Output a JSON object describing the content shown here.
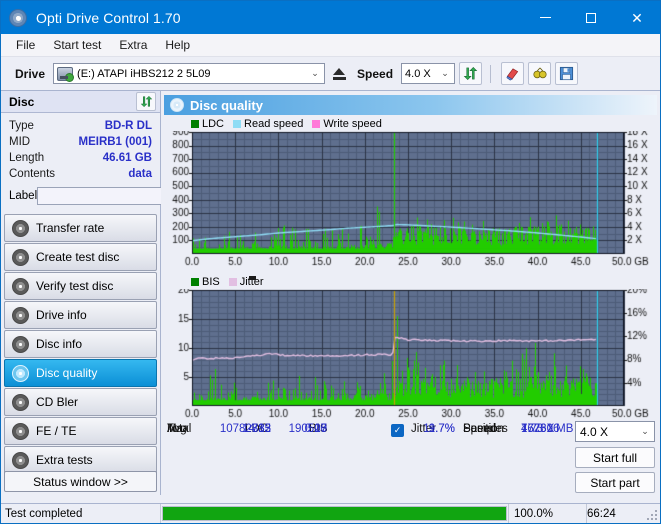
{
  "window": {
    "title": "Opti Drive Control 1.70",
    "app_icon": "disc-icon",
    "minimize": "–",
    "maximize": "□",
    "close": "✕"
  },
  "menu": {
    "items": [
      "File",
      "Start test",
      "Extra",
      "Help"
    ]
  },
  "toolbar": {
    "drive_label": "Drive",
    "drive_value": "(E:)  ATAPI iHBS212  2 5L09",
    "drive_icon": "drive-icon",
    "eject_icon": "eject-icon",
    "speed_label": "Speed",
    "speed_value": "4.0 X",
    "refresh_icon": "refresh-icon",
    "eraser_icon": "eraser-icon",
    "glasses_icon": "glasses-icon",
    "save_icon": "save-icon",
    "chevron": "⌄"
  },
  "disc_panel": {
    "header": "Disc",
    "refresh_icon": "refresh-icon",
    "rows": [
      {
        "key": "Type",
        "value": "BD-R DL"
      },
      {
        "key": "MID",
        "value": "MEIRB1 (001)"
      },
      {
        "key": "Length",
        "value": "46.61 GB"
      },
      {
        "key": "Contents",
        "value": "data"
      }
    ],
    "label_key": "Label",
    "label_value": "",
    "label_placeholder": "",
    "disc_icon": "cd-icon"
  },
  "sidebar": {
    "items": [
      {
        "label": "Transfer rate",
        "selected": false
      },
      {
        "label": "Create test disc",
        "selected": false
      },
      {
        "label": "Verify test disc",
        "selected": false
      },
      {
        "label": "Drive info",
        "selected": false
      },
      {
        "label": "Disc info",
        "selected": false
      },
      {
        "label": "Disc quality",
        "selected": true
      },
      {
        "label": "CD Bler",
        "selected": false
      },
      {
        "label": "FE / TE",
        "selected": false
      },
      {
        "label": "Extra tests",
        "selected": false
      }
    ],
    "status_window_button": "Status window >>"
  },
  "content": {
    "header_title": "Disc quality",
    "header_icon": "disc-quality-icon"
  },
  "stats": {
    "col_headers": [
      "LDC",
      "BIS"
    ],
    "row_labels": [
      "Avg",
      "Max",
      "Total"
    ],
    "ldc": {
      "avg": "14.12",
      "max": "883",
      "total": "10782735"
    },
    "bis": {
      "avg": "0.25",
      "max": "17",
      "total": "190500"
    },
    "jitter": {
      "label": "Jitter",
      "checked": true,
      "check_glyph": "✓",
      "avg": "9.7%",
      "max": "11.7%"
    },
    "speed_label": "Speed",
    "speed_value": "1.73 X",
    "position_label": "Position",
    "position_value": "47731 MB",
    "samples_label": "Samples",
    "samples_value": "762606",
    "speed_select": "4.0 X",
    "speed_select_chevron": "⌄",
    "start_full_button": "Start full",
    "start_part_button": "Start part"
  },
  "statusbar": {
    "message": "Test completed",
    "percent_text": "100.0%",
    "percent_value": 100,
    "elapsed": "66:24"
  },
  "colors": {
    "accent": "#0078d4",
    "plot_bg": "#5f6f8e",
    "grid_major": "#2b3345",
    "grid_minor": "#4d5c78",
    "ldc_green": "#22cc00",
    "bis_green": "#22cc00",
    "read_speed": "#8fdcf5",
    "write_speed": "#ff7ad9",
    "jitter": "#e2bfe2",
    "value_blue": "#2a30c8",
    "progress_green": "#11a511"
  },
  "chart_data": [
    {
      "type": "area",
      "name": "ldc-chart",
      "title": "Disc quality",
      "legend": [
        {
          "label": "LDC",
          "color": "#008000"
        },
        {
          "label": "Read speed",
          "color": "#8fdcf5"
        },
        {
          "label": "Write speed",
          "color": "#ff7ad9"
        }
      ],
      "legend_position": "top-left",
      "grid": true,
      "xlabel": "GB",
      "xlim": [
        0,
        50
      ],
      "xticks": [
        0.0,
        5.0,
        10.0,
        15.0,
        20.0,
        25.0,
        30.0,
        35.0,
        40.0,
        45.0,
        50.0
      ],
      "xticklabels": [
        "0.0",
        "5.0",
        "10.0",
        "15.0",
        "20.0",
        "25.0",
        "30.0",
        "35.0",
        "40.0",
        "45.0",
        "50.0 GB"
      ],
      "ylabel": "LDC",
      "ylim": [
        0,
        900
      ],
      "yticks": [
        100,
        200,
        300,
        400,
        500,
        600,
        700,
        800,
        900
      ],
      "y2label": "X",
      "y2lim": [
        0,
        18
      ],
      "y2ticks": [
        2,
        4,
        6,
        8,
        10,
        12,
        14,
        16,
        18
      ],
      "y2ticklabels": [
        "2 X",
        "4 X",
        "6 X",
        "8 X",
        "10 X",
        "12 X",
        "14 X",
        "16 X",
        "18 X"
      ],
      "data_end_gb": 46.9,
      "series": [
        {
          "name": "LDC",
          "color": "#22cc00",
          "kind": "spikes",
          "baseline": 40,
          "envelope_x": [
            0,
            3,
            6,
            10,
            14,
            18,
            21,
            23,
            23.5,
            25,
            28,
            32,
            36,
            40,
            44,
            46.9
          ],
          "envelope_y": [
            120,
            180,
            150,
            260,
            200,
            190,
            230,
            880,
            340,
            330,
            300,
            260,
            250,
            290,
            280,
            250
          ],
          "mean_x": [
            0,
            5,
            10,
            15,
            20,
            23,
            23.5,
            28,
            34,
            40,
            46.9
          ],
          "mean_y": [
            30,
            35,
            45,
            40,
            50,
            60,
            150,
            140,
            130,
            150,
            140
          ]
        },
        {
          "name": "Read speed",
          "color": "#8fdcf5",
          "kind": "line",
          "axis": "y2",
          "x": [
            0,
            2,
            5,
            8,
            10,
            13,
            16,
            18,
            20,
            22,
            23.3,
            23.6,
            25,
            28,
            31,
            34,
            37,
            40,
            43,
            45,
            46.9
          ],
          "y": [
            1.95,
            2.25,
            2.55,
            2.85,
            3.1,
            3.35,
            3.6,
            3.8,
            3.95,
            4.1,
            4.2,
            4.35,
            4.3,
            4.1,
            3.9,
            3.65,
            3.4,
            3.1,
            2.75,
            2.5,
            2.25
          ]
        },
        {
          "name": "Write speed",
          "color": "#ff7ad9",
          "kind": "line",
          "x": [],
          "y": []
        }
      ],
      "markers": [
        {
          "x": 23.4,
          "color": "#22cc00",
          "label": "layer-break-marker"
        },
        {
          "x": 46.9,
          "color": "#2fd0ef",
          "label": "end-of-data-marker"
        }
      ]
    },
    {
      "type": "area",
      "name": "bis-jitter-chart",
      "legend": [
        {
          "label": "BIS",
          "color": "#008000"
        },
        {
          "label": "Jitter",
          "color": "#e2bfe2"
        }
      ],
      "legend_position": "top-left",
      "grid": true,
      "xlabel": "GB",
      "xlim": [
        0,
        50
      ],
      "xticks": [
        0.0,
        5.0,
        10.0,
        15.0,
        20.0,
        25.0,
        30.0,
        35.0,
        40.0,
        45.0,
        50.0
      ],
      "xticklabels": [
        "0.0",
        "5.0",
        "10.0",
        "15.0",
        "20.0",
        "25.0",
        "30.0",
        "35.0",
        "40.0",
        "45.0",
        "50.0 GB"
      ],
      "ylabel": "BIS",
      "ylim": [
        0,
        20
      ],
      "yticks": [
        5,
        10,
        15,
        20
      ],
      "y2label": "%",
      "y2lim": [
        0,
        20
      ],
      "y2ticks": [
        4,
        8,
        12,
        16,
        20
      ],
      "y2ticklabels": [
        "4%",
        "8%",
        "12%",
        "16%",
        "20%"
      ],
      "data_end_gb": 46.9,
      "series": [
        {
          "name": "BIS",
          "color": "#22cc00",
          "kind": "spikes",
          "baseline": 1.0,
          "envelope_x": [
            0,
            3,
            6,
            9,
            12,
            15,
            18,
            21,
            23,
            23.4,
            25,
            28,
            32,
            36,
            40,
            44,
            46.9
          ],
          "envelope_y": [
            3.0,
            6.8,
            3.2,
            6.0,
            5.5,
            5.2,
            4.6,
            6.5,
            6.8,
            17.0,
            10.0,
            8.3,
            7.0,
            6.5,
            12.0,
            7.5,
            7.0
          ],
          "mean_x": [
            0,
            5,
            10,
            15,
            20,
            23,
            23.5,
            28,
            34,
            40,
            46.9
          ],
          "mean_y": [
            1.0,
            1.1,
            1.2,
            1.1,
            1.4,
            1.6,
            3.2,
            3.0,
            3.0,
            3.1,
            3.0
          ]
        },
        {
          "name": "Jitter",
          "color": "#e2bfe2",
          "kind": "line",
          "axis": "y2",
          "x": [
            0,
            1,
            2,
            4,
            6,
            8,
            9,
            11,
            13,
            15,
            17,
            19,
            21,
            22.5,
            23.2,
            23.5,
            25,
            28,
            31,
            34,
            37,
            40,
            43,
            45,
            46.9
          ],
          "y": [
            7.9,
            8.3,
            8.2,
            8.25,
            8.4,
            8.8,
            9.0,
            8.7,
            8.7,
            8.6,
            8.7,
            8.75,
            8.85,
            8.9,
            8.6,
            11.9,
            11.4,
            11.3,
            11.2,
            11.2,
            11.3,
            11.2,
            11.3,
            11.4,
            11.5
          ]
        }
      ],
      "markers": [
        {
          "x": 23.4,
          "color": "#c8a000",
          "label": "layer-break-marker"
        },
        {
          "x": 46.9,
          "color": "#2fd0ef",
          "label": "end-of-data-marker"
        }
      ]
    }
  ]
}
